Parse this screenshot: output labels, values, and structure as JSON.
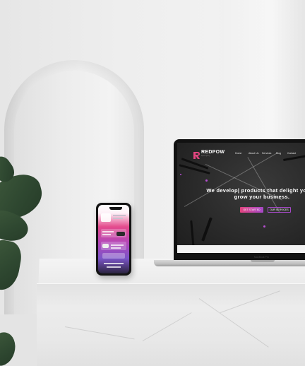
{
  "laptop": {
    "brand": "REDPOW",
    "brand_tagline": "digital agency",
    "nav": [
      "Home",
      "About Us",
      "Services",
      "Blog",
      "Contact"
    ],
    "hero_line1": "We develop| products that delight your u",
    "hero_line2": "grow your business.",
    "cta_primary": "GET STARTED",
    "cta_secondary": "OUR SERVICES",
    "model_label": "MacBook Pro"
  },
  "colors": {
    "accent_pink": "#e2457f",
    "accent_purple": "#a649c9",
    "screen_dark": "#2a2a2a"
  }
}
